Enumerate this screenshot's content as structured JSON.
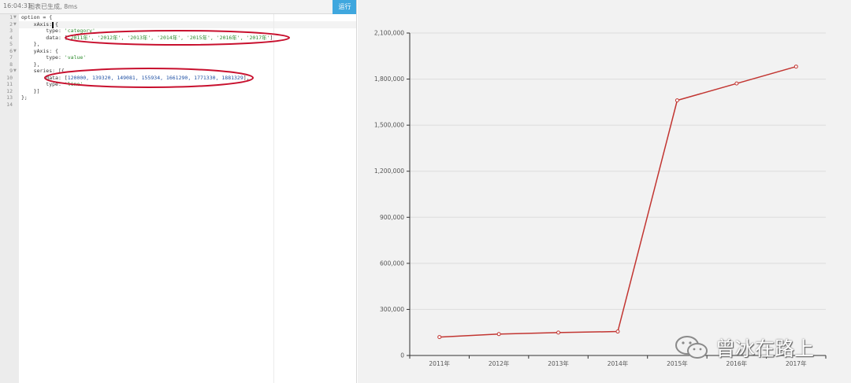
{
  "toolbar": {
    "time": "16:04:31",
    "status": "图表已生成, 8ms",
    "run_label": "运行"
  },
  "editor": {
    "line_numbers": [
      "1",
      "2",
      "3",
      "4",
      "5",
      "6",
      "7",
      "8",
      "9",
      "10",
      "11",
      "12",
      "13",
      "14"
    ],
    "code": {
      "l1": "option = {",
      "l2": "    xAxis: {",
      "l3_key": "        type: ",
      "l3_val": "'category'",
      "l4_key": "        data: [",
      "l4_val": "'2011年', '2012年', '2013年', '2014年', '2015年', '2016年', '2017年'",
      "l4_end": "]",
      "l5": "    },",
      "l6": "    yAxis: {",
      "l7_key": "        type: ",
      "l7_val": "'value'",
      "l8": "    },",
      "l9": "    series: [{",
      "l10_key": "        data: [",
      "l10_val": "120000, 139320, 149081, 155934, 1661290, 1771330, 1881329",
      "l10_end": "],",
      "l11_key": "        type: ",
      "l11_val": "'line'",
      "l12": "    }]",
      "l13": "};",
      "l14": ""
    }
  },
  "chart_data": {
    "type": "line",
    "categories": [
      "2011年",
      "2012年",
      "2013年",
      "2014年",
      "2015年",
      "2016年",
      "2017年"
    ],
    "series": [
      {
        "values": [
          120000,
          139320,
          149081,
          155934,
          1661290,
          1771330,
          1881329
        ]
      }
    ],
    "ylim": [
      0,
      2100000
    ],
    "yticks": [
      0,
      300000,
      600000,
      900000,
      1200000,
      1500000,
      1800000,
      2100000
    ],
    "ytick_labels": [
      "0",
      "300,000",
      "600,000",
      "900,000",
      "1,200,000",
      "1,500,000",
      "1,800,000",
      "2,100,000"
    ],
    "grid": true,
    "line_color": "#c23531"
  },
  "watermark": {
    "text": "曾冰在路上",
    "icon": "wechat-icon"
  }
}
